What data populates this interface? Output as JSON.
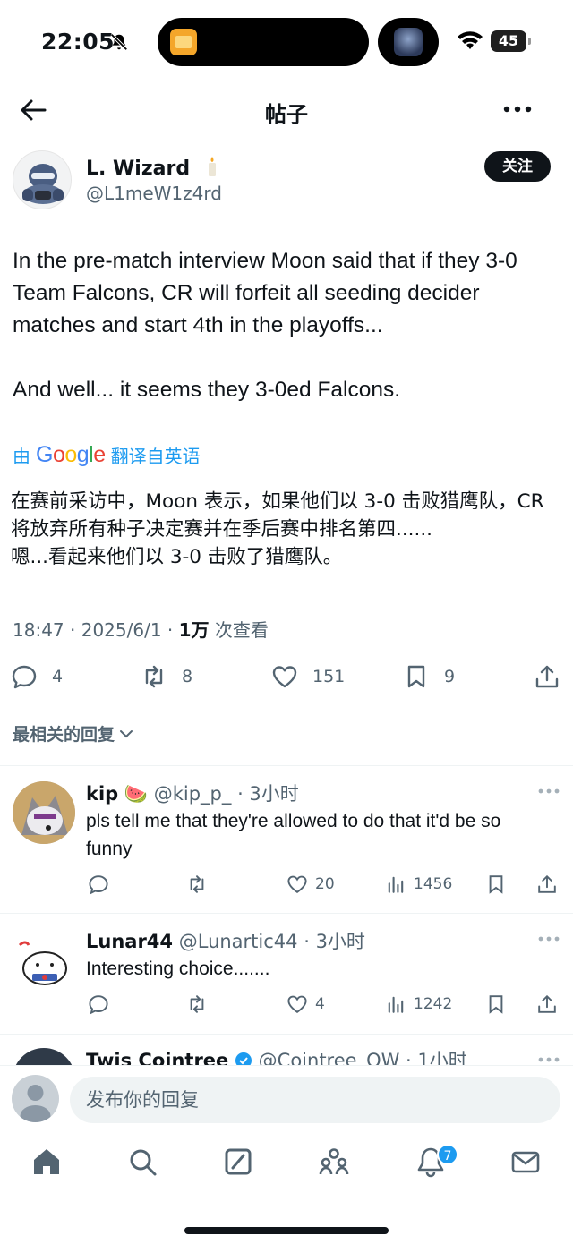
{
  "status_bar": {
    "time": "22:05",
    "battery": "45"
  },
  "header": {
    "title": "帖子"
  },
  "post": {
    "author_name": "L. Wizard",
    "author_handle": "@L1meW1z4rd",
    "follow_label": "关注",
    "text_p1": "In the pre-match interview Moon said that if they 3-0 Team Falcons, CR will forfeit all seeding decider matches and start 4th in the playoffs...",
    "text_p2": "And well... it seems they 3-0ed Falcons.",
    "translated_prefix": "由",
    "translated_brand": "Google",
    "translated_suffix": "翻译自英语",
    "translation_p1": "在赛前采访中，Moon 表示，如果他们以 3-0 击败猎鹰队，CR 将放弃所有种子决定赛并在季后赛中排名第四......",
    "translation_p2": "嗯...看起来他们以 3-0 击败了猎鹰队。",
    "time": "18:47",
    "date": "2025/6/1",
    "views_count": "1万",
    "views_label": "次查看",
    "replies": "4",
    "reposts": "8",
    "likes": "151",
    "bookmarks": "9"
  },
  "sort_label": "最相关的回复",
  "replies": [
    {
      "name": "kip",
      "emoji": "🍉",
      "handle": "@kip_p_",
      "time": "3小时",
      "text": "pls tell me that they're allowed to do that it'd be so funny",
      "likes": "20",
      "views": "1456"
    },
    {
      "name": "Lunar44",
      "handle": "@Lunartic44",
      "time": "3小时",
      "text": "Interesting choice.......",
      "likes": "4",
      "views": "1242"
    },
    {
      "name": "Twis Cointree",
      "handle": "@Cointree_OW",
      "time": "1小时"
    }
  ],
  "compose": {
    "placeholder": "发布你的回复"
  },
  "tabbar": {
    "notification_count": "7"
  },
  "colors": {
    "accent": "#1d9bf0",
    "text": "#0f1419",
    "muted": "#536471"
  }
}
